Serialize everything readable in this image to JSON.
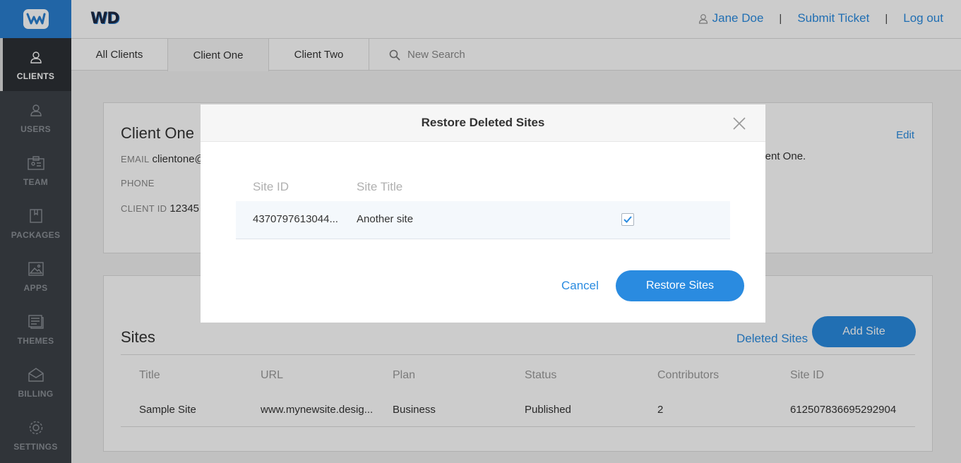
{
  "brand": {
    "logo_icon": "weebly-w-icon",
    "wd_logo": "WD",
    "accent": "#2a8be0",
    "sidebar_bg": "#3d4248"
  },
  "sidebar": {
    "items": [
      {
        "label": "CLIENTS",
        "icon": "user-icon",
        "active": true
      },
      {
        "label": "USERS",
        "icon": "user-icon"
      },
      {
        "label": "TEAM",
        "icon": "id-card-icon"
      },
      {
        "label": "PACKAGES",
        "icon": "package-icon"
      },
      {
        "label": "APPS",
        "icon": "image-icon"
      },
      {
        "label": "THEMES",
        "icon": "theme-icon"
      },
      {
        "label": "BILLING",
        "icon": "billing-icon"
      },
      {
        "label": "SETTINGS",
        "icon": "gear-icon"
      }
    ]
  },
  "header": {
    "user_name": "Jane Doe",
    "sep": "|",
    "submit_ticket": "Submit Ticket",
    "logout": "Log out"
  },
  "tabs": {
    "items": [
      "All Clients",
      "Client One",
      "Client Two"
    ],
    "search_placeholder": "New Search"
  },
  "client": {
    "name": "Client One",
    "email_label": "EMAIL",
    "email_value": "clientone@",
    "phone_label": "PHONE",
    "client_id_label": "CLIENT ID",
    "client_id_value": "12345",
    "edit": "Edit",
    "description": "lient One."
  },
  "sites": {
    "title": "Sites",
    "deleted_link": "Deleted Sites",
    "add_button": "Add Site",
    "columns": [
      "Title",
      "URL",
      "Plan",
      "Status",
      "Contributors",
      "Site ID"
    ],
    "rows": [
      [
        "Sample Site",
        "www.mynewsite.desig...",
        "Business",
        "Published",
        "2",
        "612507836695292904"
      ]
    ]
  },
  "modal": {
    "title": "Restore Deleted Sites",
    "columns": [
      "Site ID",
      "Site Title"
    ],
    "row": {
      "site_id": "4370797613044...",
      "site_title": "Another site",
      "checked": true
    },
    "cancel": "Cancel",
    "restore": "Restore Sites"
  }
}
